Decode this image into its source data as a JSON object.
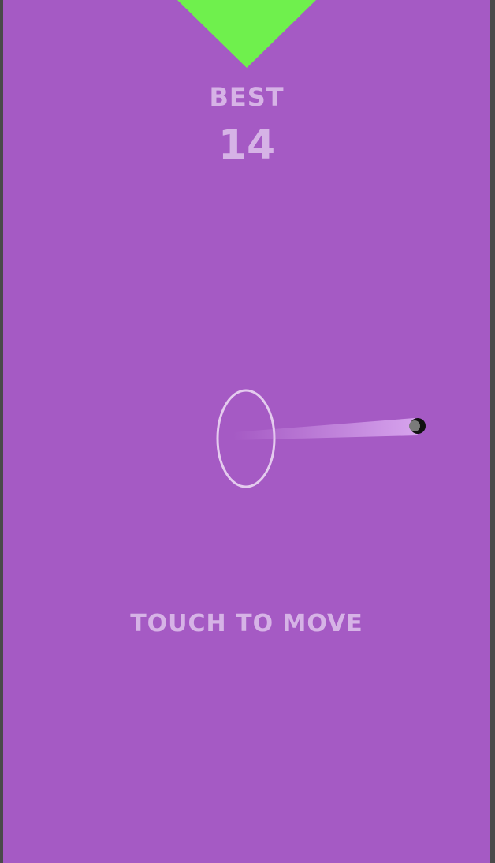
{
  "hud": {
    "best_label": "BEST",
    "best_value": "14"
  },
  "hint": {
    "text": "TOUCH TO MOVE"
  },
  "colors": {
    "background": "#a55ac4",
    "triangle": "#6ff04d",
    "text": "#d6b3e6",
    "ring": "#e4cbee",
    "ball": "#111111",
    "ball_highlight": "#7a7a7a",
    "trail": "#d9a7ef"
  },
  "icons": {
    "target": "down-triangle",
    "ball": "circle",
    "ring": "ellipse-outline"
  }
}
